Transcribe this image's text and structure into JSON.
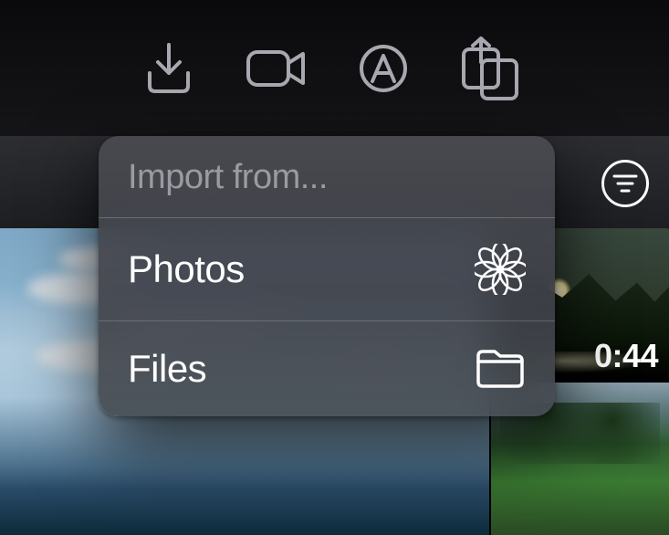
{
  "toolbar": {
    "icons": [
      "import-icon",
      "camera-icon",
      "markup-icon",
      "share-icon"
    ]
  },
  "filter": {
    "name": "filter-icon"
  },
  "popover": {
    "title": "Import from...",
    "items": [
      {
        "label": "Photos",
        "icon": "photos-icon"
      },
      {
        "label": "Files",
        "icon": "folder-icon"
      }
    ]
  },
  "thumbnails": {
    "top_right": {
      "duration": "0:44"
    }
  }
}
